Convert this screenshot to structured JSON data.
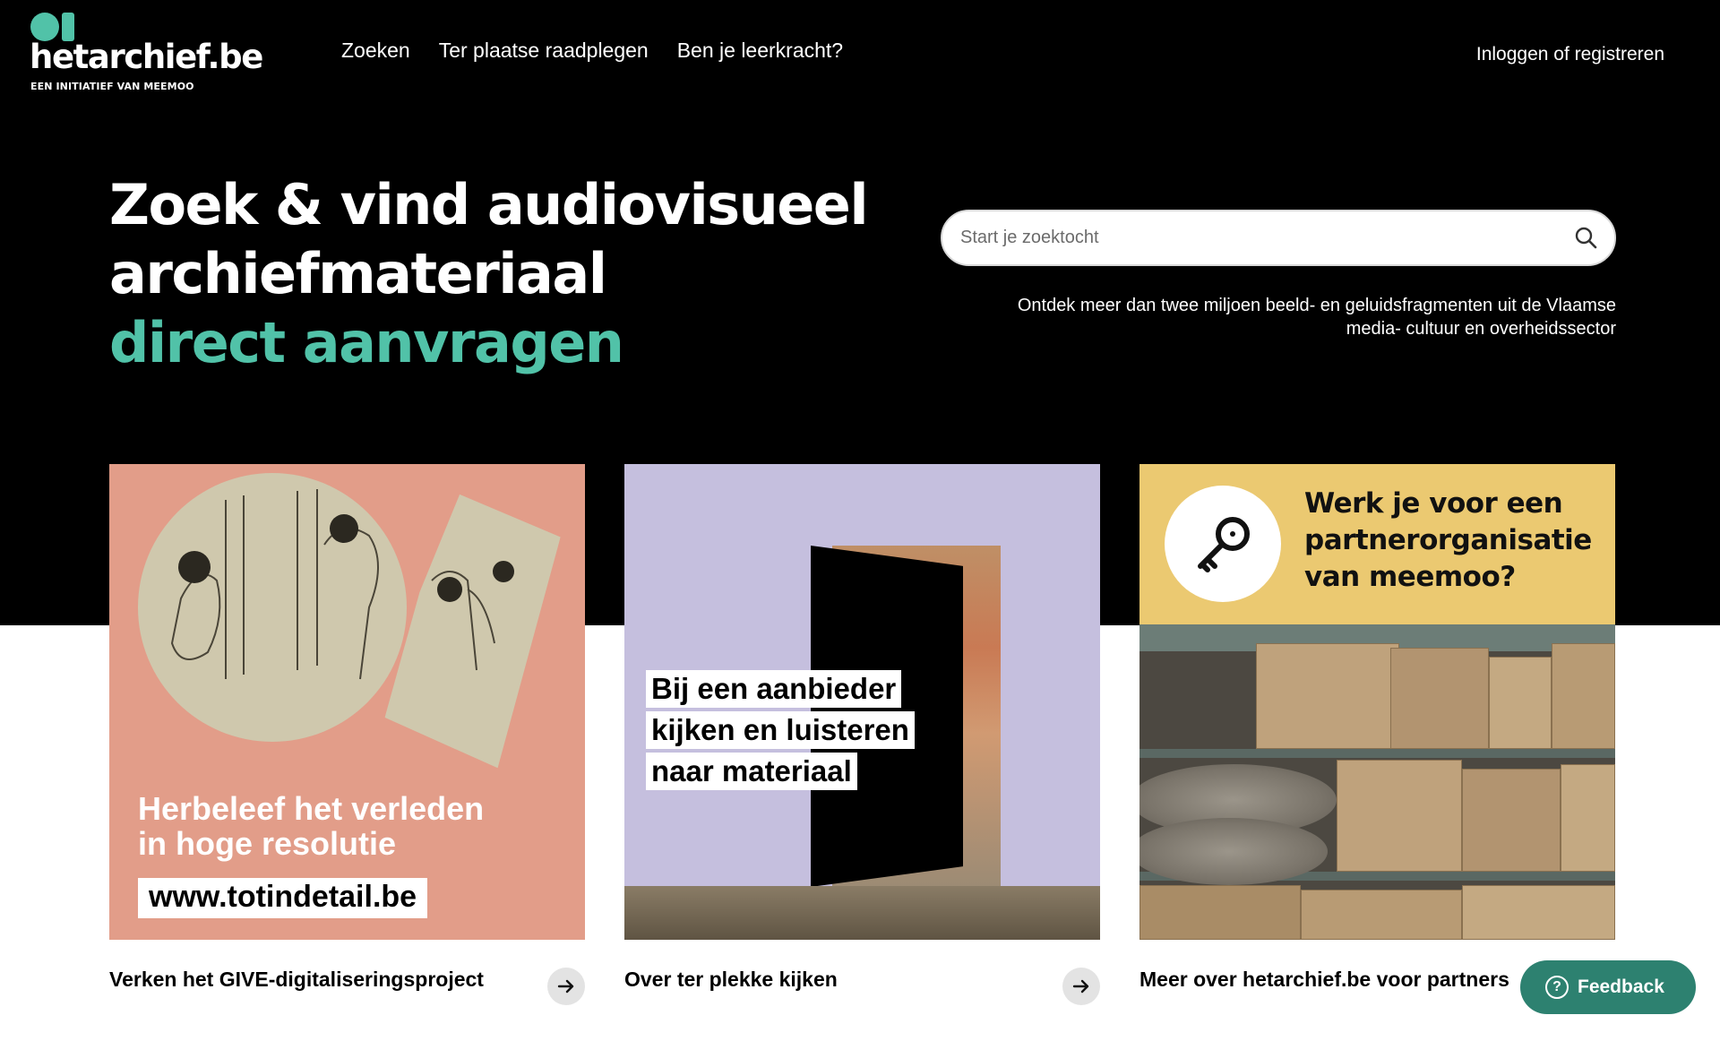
{
  "header": {
    "logo": {
      "name": "hetarchief.be",
      "tagline": "EEN INITIATIEF VAN MEEMOO"
    },
    "nav": [
      {
        "label": "Zoeken"
      },
      {
        "label": "Ter plaatse raadplegen"
      },
      {
        "label": "Ben je leerkracht?"
      }
    ],
    "login_label": "Inloggen of registreren"
  },
  "hero": {
    "headline_line1": "Zoek & vind audiovisueel",
    "headline_line2": "archiefmateriaal",
    "headline_accent": "direct aanvragen",
    "accent_color": "#51c2a8",
    "search": {
      "placeholder": "Start je zoektocht",
      "value": ""
    },
    "tagline_line1": "Ontdek meer dan twee miljoen beeld- en geluidsfragmenten uit de Vlaamse",
    "tagline_line2": "media- cultuur en overheidssector"
  },
  "cards": [
    {
      "caption_line1": "Herbeleef het verleden",
      "caption_line2": "in hoge resolutie",
      "url": "www.totindetail.be",
      "footer": "Verken het GIVE-digitaliseringsproject",
      "bg_color": "#e29d89"
    },
    {
      "caption_line1": "Bij een aanbieder",
      "caption_line2": "kijken en luisteren",
      "caption_line3": "naar materiaal",
      "footer": "Over ter plekke kijken",
      "bg_color": "#c5bfde"
    },
    {
      "banner_line1": "Werk je voor een",
      "banner_line2": "partnerorganisatie",
      "banner_line3": "van meemoo?",
      "footer": "Meer over hetarchief.be voor partners",
      "bg_color": "#ebc971",
      "icon": "key-icon"
    }
  ],
  "feedback": {
    "label": "Feedback",
    "icon": "question-circle-icon",
    "color": "#2d8170"
  }
}
